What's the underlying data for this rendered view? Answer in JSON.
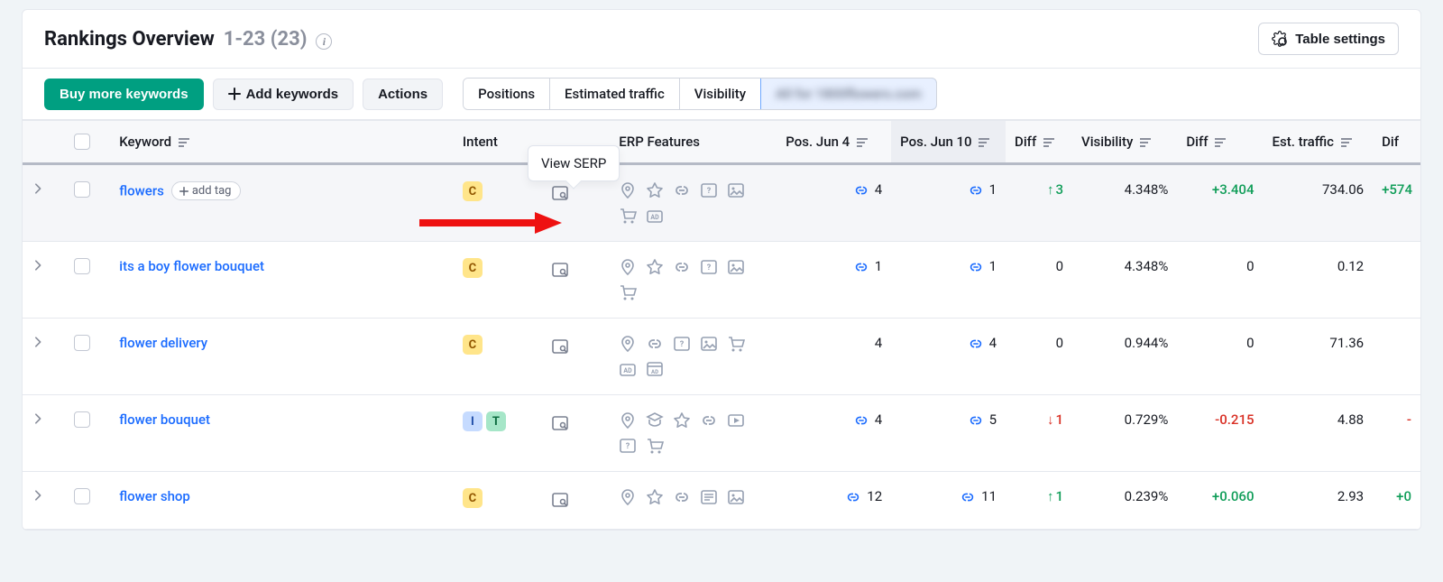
{
  "header": {
    "title": "Rankings Overview",
    "count_range": "1-23",
    "count_total": "(23)",
    "settings_label": "Table settings"
  },
  "toolbar": {
    "buy": "Buy more keywords",
    "add": "Add keywords",
    "actions": "Actions",
    "tabs": {
      "positions": "Positions",
      "traffic": "Estimated traffic",
      "visibility": "Visibility",
      "blurred": "All for 1800flowers.com"
    }
  },
  "tooltip": {
    "view_serp": "View SERP"
  },
  "columns": {
    "keyword": "Keyword",
    "intent": "Intent",
    "serp_features": "ERP Features",
    "pos1": "Pos. Jun 4",
    "pos2": "Pos. Jun 10",
    "diff1": "Diff",
    "visibility": "Visibility",
    "diff2": "Diff",
    "traffic": "Est. traffic",
    "diff3": "Dif"
  },
  "rows": [
    {
      "keyword": "flowers",
      "add_tag": "add tag",
      "intents": [
        "C"
      ],
      "features": [
        "map-pin",
        "star",
        "link",
        "featured-snippet",
        "image",
        "shopping",
        "ads"
      ],
      "pos1_icon": true,
      "pos1": "4",
      "pos2_icon": true,
      "pos2": "1",
      "diff1": {
        "dir": "up",
        "text": "3"
      },
      "visibility": "4.348%",
      "diff2": {
        "dir": "up",
        "text": "+3.404"
      },
      "traffic": "734.06",
      "diff3": {
        "dir": "up",
        "text": "+574"
      }
    },
    {
      "keyword": "its a boy flower bouquet",
      "intents": [
        "C"
      ],
      "features": [
        "map-pin",
        "star",
        "link",
        "featured-snippet",
        "image",
        "shopping"
      ],
      "pos1_icon": true,
      "pos1": "1",
      "pos2_icon": true,
      "pos2": "1",
      "diff1": {
        "dir": "zero",
        "text": "0"
      },
      "visibility": "4.348%",
      "diff2": {
        "dir": "zero",
        "text": "0"
      },
      "traffic": "0.12",
      "diff3": {
        "dir": "zero",
        "text": ""
      }
    },
    {
      "keyword": "flower delivery",
      "intents": [
        "C"
      ],
      "features": [
        "map-pin",
        "link",
        "featured-snippet",
        "image",
        "shopping",
        "ads",
        "ads-bottom"
      ],
      "pos1_icon": false,
      "pos1": "4",
      "pos2_icon": true,
      "pos2": "4",
      "diff1": {
        "dir": "zero",
        "text": "0"
      },
      "visibility": "0.944%",
      "diff2": {
        "dir": "zero",
        "text": "0"
      },
      "traffic": "71.36",
      "diff3": {
        "dir": "zero",
        "text": ""
      }
    },
    {
      "keyword": "flower bouquet",
      "intents": [
        "I",
        "T"
      ],
      "features": [
        "map-pin",
        "knowledge",
        "star",
        "link",
        "video",
        "featured-snippet",
        "shopping"
      ],
      "pos1_icon": true,
      "pos1": "4",
      "pos2_icon": true,
      "pos2": "5",
      "diff1": {
        "dir": "down",
        "text": "1"
      },
      "visibility": "0.729%",
      "diff2": {
        "dir": "down",
        "text": "-0.215"
      },
      "traffic": "4.88",
      "diff3": {
        "dir": "down",
        "text": "-"
      }
    },
    {
      "keyword": "flower shop",
      "intents": [
        "C"
      ],
      "features": [
        "map-pin",
        "star",
        "link",
        "text",
        "image"
      ],
      "pos1_icon": true,
      "pos1": "12",
      "pos2_icon": true,
      "pos2": "11",
      "diff1": {
        "dir": "up",
        "text": "1"
      },
      "visibility": "0.239%",
      "diff2": {
        "dir": "up",
        "text": "+0.060"
      },
      "traffic": "2.93",
      "diff3": {
        "dir": "up",
        "text": "+0"
      }
    }
  ]
}
